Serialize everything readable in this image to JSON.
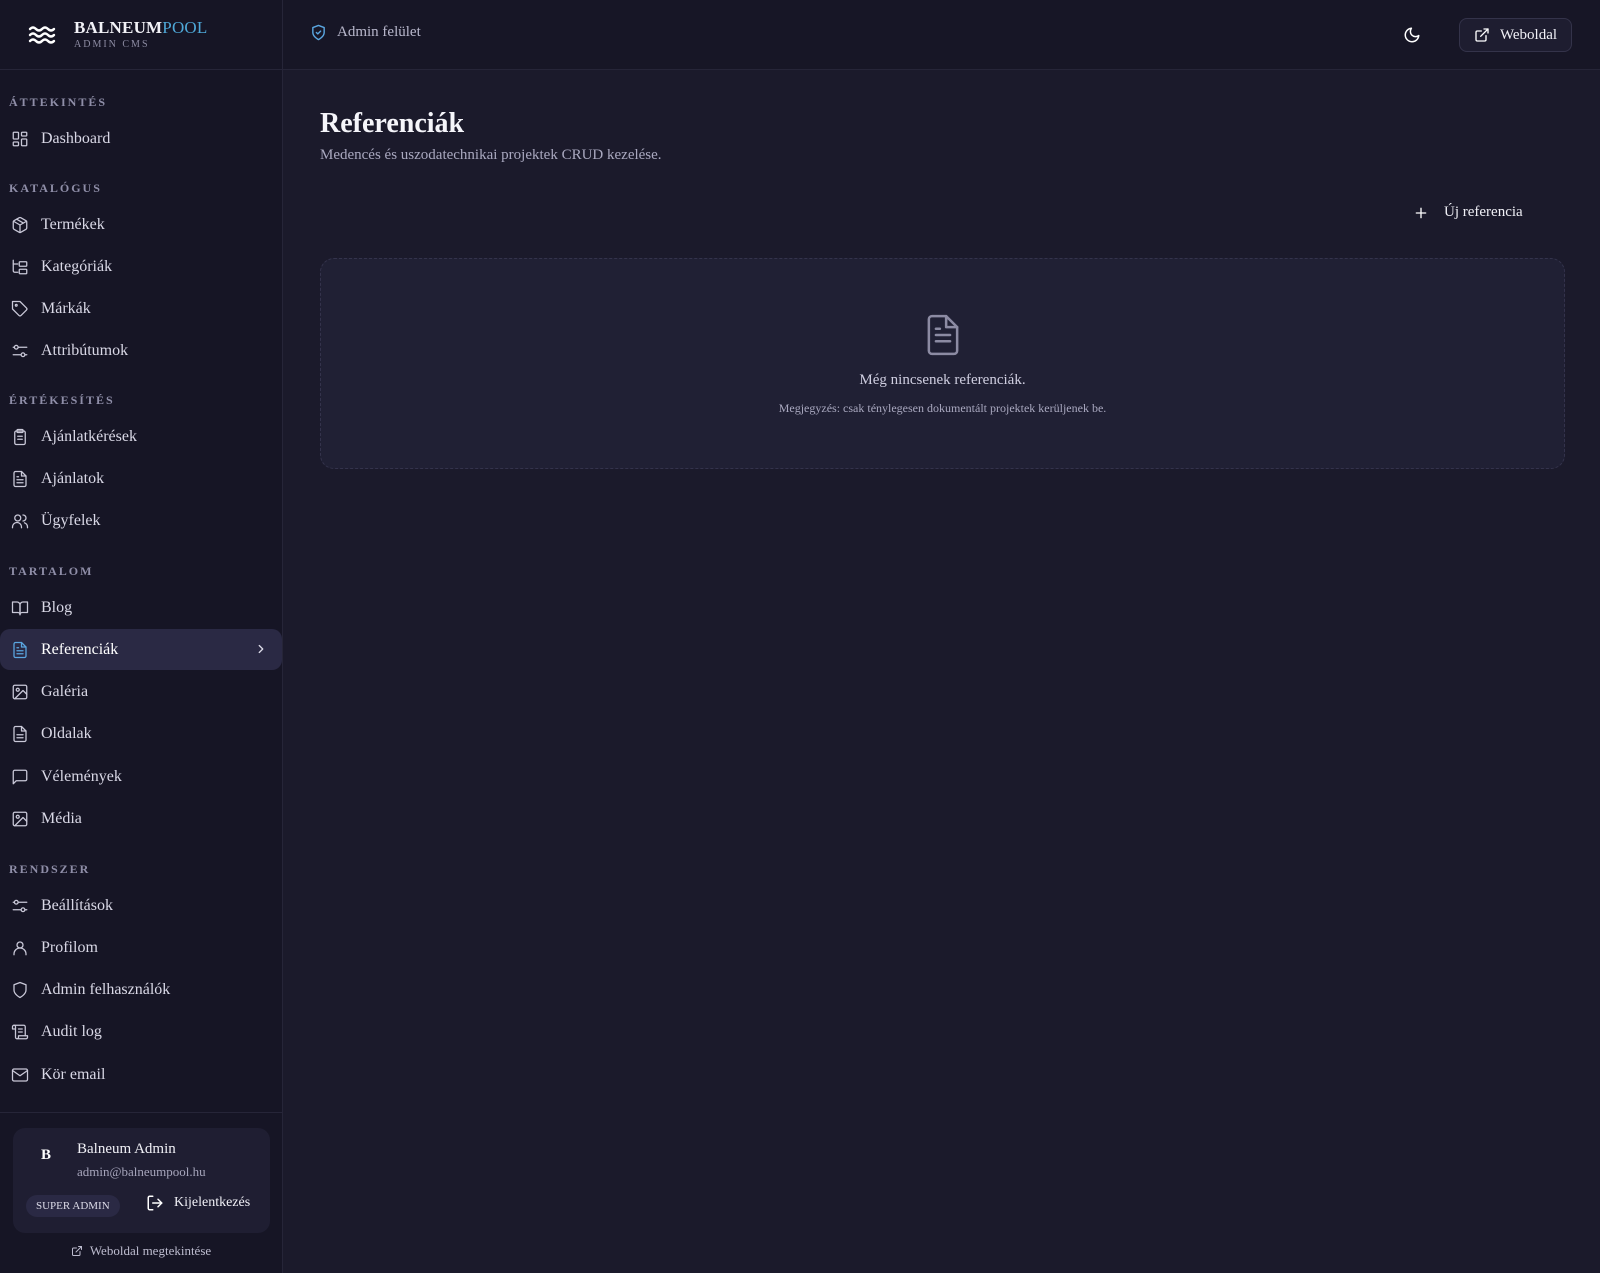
{
  "brand": {
    "name_main": "BALNEUM",
    "name_accent": "POOL",
    "subtitle": "ADMIN CMS"
  },
  "sidebar": {
    "sections": [
      {
        "title": "ÁTTEKINTÉS",
        "items": [
          {
            "label": "Dashboard",
            "icon": "grid-icon"
          }
        ]
      },
      {
        "title": "KATALÓGUS",
        "items": [
          {
            "label": "Termékek",
            "icon": "package-icon"
          },
          {
            "label": "Kategóriák",
            "icon": "folder-tree-icon"
          },
          {
            "label": "Márkák",
            "icon": "tag-icon"
          },
          {
            "label": "Attribútumok",
            "icon": "sliders-icon"
          }
        ]
      },
      {
        "title": "ÉRTÉKESÍTÉS",
        "items": [
          {
            "label": "Ajánlatkérések",
            "icon": "clipboard-icon"
          },
          {
            "label": "Ajánlatok",
            "icon": "file-text-icon"
          },
          {
            "label": "Ügyfelek",
            "icon": "users-icon"
          }
        ]
      },
      {
        "title": "TARTALOM",
        "items": [
          {
            "label": "Blog",
            "icon": "book-icon"
          },
          {
            "label": "Referenciák",
            "icon": "file-text-icon",
            "active": true
          },
          {
            "label": "Galéria",
            "icon": "image-icon"
          },
          {
            "label": "Oldalak",
            "icon": "file-icon"
          },
          {
            "label": "Vélemények",
            "icon": "message-icon"
          },
          {
            "label": "Média",
            "icon": "image-icon"
          }
        ]
      },
      {
        "title": "RENDSZER",
        "items": [
          {
            "label": "Beállítások",
            "icon": "sliders-icon"
          },
          {
            "label": "Profilom",
            "icon": "user-icon"
          },
          {
            "label": "Admin felhasználók",
            "icon": "shield-icon"
          },
          {
            "label": "Audit log",
            "icon": "scroll-icon"
          },
          {
            "label": "Kör email",
            "icon": "mail-icon"
          }
        ]
      }
    ],
    "user": {
      "initial": "B",
      "name": "Balneum Admin",
      "email": "admin@balneumpool.hu",
      "role": "SUPER ADMIN",
      "logout_label": "Kijelentkezés"
    },
    "view_site_label": "Weboldal megtekintése"
  },
  "topbar": {
    "breadcrumb": "Admin felület",
    "site_button": "Weboldal"
  },
  "main": {
    "title": "Referenciák",
    "subtitle": "Medencés és uszodatechnikai projektek CRUD kezelése.",
    "new_button": "Új referencia",
    "empty_title": "Még nincsenek referenciák.",
    "empty_note": "Megjegyzés: csak ténylegesen dokumentált projektek kerüljenek be."
  },
  "colors": {
    "background": "#1b1a2b",
    "sidebar": "#161525",
    "accent": "#4ea8d8",
    "active_bg": "#2a2944"
  }
}
